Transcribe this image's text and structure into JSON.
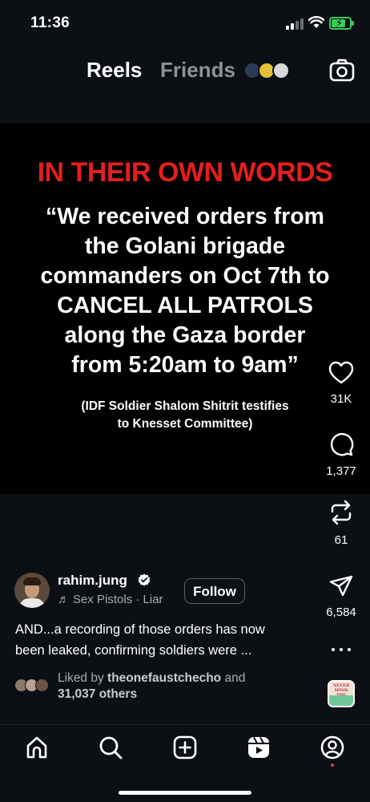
{
  "status_bar": {
    "time": "11:36",
    "icons": [
      "cellular-signal-icon",
      "wifi-icon",
      "battery-charging-icon"
    ],
    "battery_color": "#3ec957"
  },
  "top_tabs": {
    "reels_label": "Reels",
    "friends_label": "Friends",
    "camera_icon": "camera-icon"
  },
  "video": {
    "headline": "IN THEIR OWN WORDS",
    "headline_color": "#e31e1e",
    "quote": "“We received orders from\nthe Golani brigade\ncommanders on Oct 7th to\nCANCEL ALL PATROLS\nalong the Gaza border\nfrom 5:20am to 9am”",
    "attribution": "(IDF Soldier Shalom Shitrit testifies\nto Knesset Committee)"
  },
  "actions": {
    "likes_count": "31K",
    "comments_count": "1,377",
    "reposts_count": "61",
    "shares_count": "6,584"
  },
  "post": {
    "username": "rahim.jung",
    "audio": "Sex Pistols · Liar",
    "follow_label": "Follow",
    "caption": "AND...a recording of those orders has now\nbeen leaked, confirming soldiers were ...",
    "liked_by_prefix": "Liked by ",
    "liked_by_user": "theonefaustchecho",
    "liked_by_and": " and",
    "liked_by_others": "31,037 others"
  },
  "audio_thumb": {
    "text": "NEVER MIND THE BOLLOCKS"
  },
  "bottom_nav": {
    "items": [
      "home-icon",
      "search-icon",
      "create-icon",
      "reels-icon",
      "profile-icon"
    ],
    "notification_color": "#ff3040"
  }
}
